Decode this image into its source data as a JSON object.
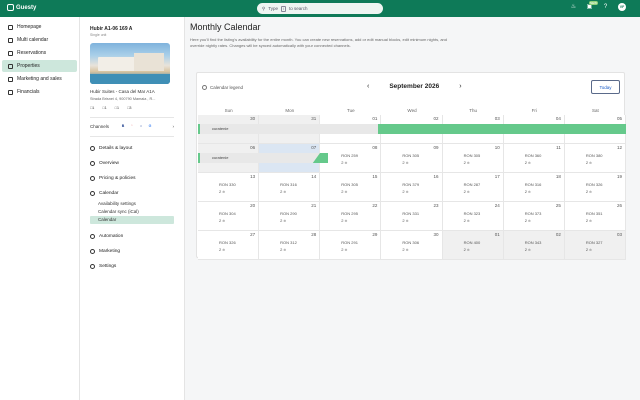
{
  "topbar": {
    "logo": "Guesty",
    "search_placeholder": "Type",
    "search_key": "/",
    "search_suffix": "to search",
    "badge": "NEW",
    "avatar": "VF",
    "icons": [
      "bell-icon",
      "gift-icon",
      "help-icon"
    ]
  },
  "nav": {
    "items": [
      {
        "label": "Homepage",
        "icon": "home-icon",
        "active": false
      },
      {
        "label": "Multi calendar",
        "icon": "calendar-icon",
        "active": false
      },
      {
        "label": "Reservations",
        "icon": "reservations-icon",
        "active": false
      },
      {
        "label": "Properties",
        "icon": "properties-icon",
        "active": true
      },
      {
        "label": "Marketing and sales",
        "icon": "marketing-icon",
        "active": false
      },
      {
        "label": "Financials",
        "icon": "financials-icon",
        "active": false
      }
    ]
  },
  "property": {
    "title": "Hubir A1-06 169 A",
    "subtitle": "Single unit",
    "name": "Hubir Suites - Casa del Mar A1A",
    "address": "Strada Brisnei 4, 900790 Mamaia , R...",
    "stats": [
      "1",
      "1",
      "1",
      "3"
    ],
    "channels_label": "Channels",
    "channels": [
      "B",
      "‘",
      "⌂",
      "G"
    ],
    "sections": [
      {
        "label": "Details & layout",
        "icon": "details-icon"
      },
      {
        "label": "Overview",
        "icon": "overview-icon"
      },
      {
        "label": "Pricing & policies",
        "icon": "pricing-icon"
      },
      {
        "label": "Calendar",
        "icon": "calendar-icon"
      }
    ],
    "calendar_subitems": [
      {
        "label": "Availability settings",
        "active": false
      },
      {
        "label": "Calendar sync (iCal)",
        "active": false
      },
      {
        "label": "Calendar",
        "active": true
      }
    ],
    "more_sections": [
      {
        "label": "Automation",
        "icon": "automation-icon"
      },
      {
        "label": "Marketing",
        "icon": "marketing-icon"
      },
      {
        "label": "Settings",
        "icon": "settings-icon"
      }
    ]
  },
  "main": {
    "title": "Monthly Calendar",
    "description": "Here you'll find the listing's availability for the entire month. You can create new reservations, add or edit manual blocks, edit minimum nights, and override nightly rates. Changes will be synced automatically with your connected channels.",
    "legend_label": "Calendar legend",
    "month": "September 2026",
    "today_label": "Today",
    "days_of_week": [
      "Sun",
      "Mon",
      "Tue",
      "Wed",
      "Thu",
      "Fri",
      "Sat"
    ],
    "booking_label": "curatenie",
    "weeks": [
      [
        {
          "num": "30",
          "grey": true
        },
        {
          "num": "31",
          "grey": true
        },
        {
          "num": "01"
        },
        {
          "num": "02"
        },
        {
          "num": "03"
        },
        {
          "num": "04"
        },
        {
          "num": "05"
        }
      ],
      [
        {
          "num": "06",
          "grey": true
        },
        {
          "num": "07",
          "sel": true
        },
        {
          "num": "08",
          "price": "RON 259",
          "avail": "2"
        },
        {
          "num": "09",
          "price": "RON 305",
          "avail": "2"
        },
        {
          "num": "10",
          "price": "RON 305",
          "avail": "2"
        },
        {
          "num": "11",
          "price": "RON 360",
          "avail": "2"
        },
        {
          "num": "12",
          "price": "RON 380",
          "avail": "2"
        }
      ],
      [
        {
          "num": "13",
          "price": "RON 330",
          "avail": "2"
        },
        {
          "num": "14",
          "price": "RON 316",
          "avail": "2"
        },
        {
          "num": "15",
          "price": "RON 305",
          "avail": "2"
        },
        {
          "num": "16",
          "price": "RON 379",
          "avail": "2"
        },
        {
          "num": "17",
          "price": "RON 287",
          "avail": "2"
        },
        {
          "num": "18",
          "price": "RON 316",
          "avail": "2"
        },
        {
          "num": "19",
          "price": "RON 326",
          "avail": "2"
        }
      ],
      [
        {
          "num": "20",
          "price": "RON 304",
          "avail": "2"
        },
        {
          "num": "21",
          "price": "RON 290",
          "avail": "2"
        },
        {
          "num": "22",
          "price": "RON 295",
          "avail": "2"
        },
        {
          "num": "23",
          "price": "RON 331",
          "avail": "2"
        },
        {
          "num": "24",
          "price": "RON 323",
          "avail": "2"
        },
        {
          "num": "25",
          "price": "RON 373",
          "avail": "2"
        },
        {
          "num": "26",
          "price": "RON 351",
          "avail": "2"
        }
      ],
      [
        {
          "num": "27",
          "price": "RON 326",
          "avail": "2"
        },
        {
          "num": "28",
          "price": "RON 312",
          "avail": "2"
        },
        {
          "num": "29",
          "price": "RON 291",
          "avail": "2"
        },
        {
          "num": "30",
          "price": "RON 306",
          "avail": "2"
        },
        {
          "num": "01",
          "price": "RON 400",
          "avail": "2",
          "grey": true
        },
        {
          "num": "02",
          "price": "RON 343",
          "avail": "2",
          "grey": true
        },
        {
          "num": "03",
          "price": "RON 327",
          "avail": "2",
          "grey": true
        }
      ]
    ]
  }
}
